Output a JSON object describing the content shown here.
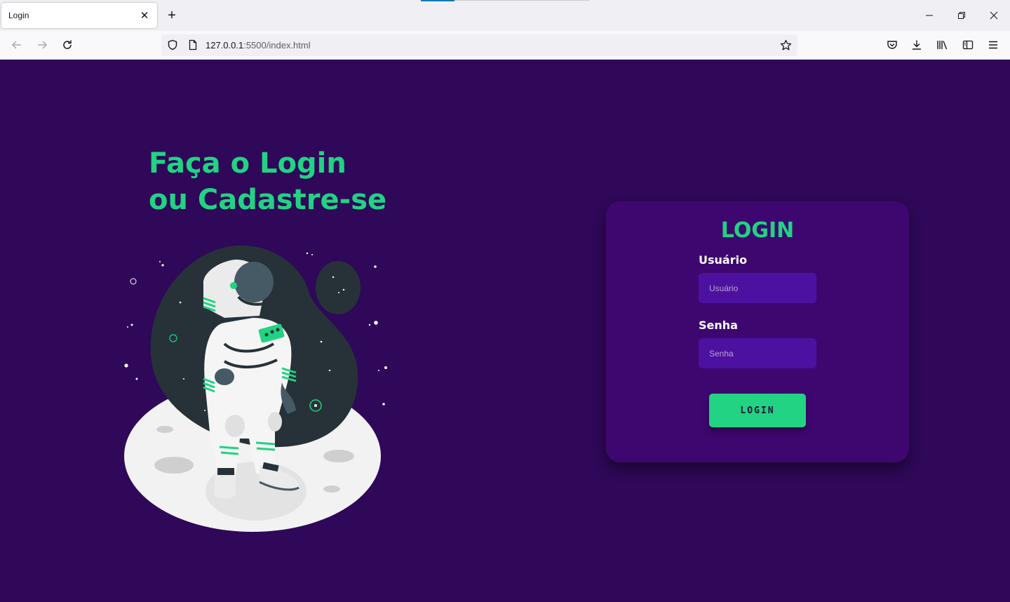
{
  "browser": {
    "tab_title": "Login",
    "tab_close_glyph": "✕",
    "new_tab_glyph": "+",
    "url_host": "127.0.0.1",
    "url_rest": ":5500/index.html"
  },
  "page": {
    "headline_line1": "Faça o Login",
    "headline_line2": "ou Cadastre-se",
    "illustration_subject": "astronaut-on-moon"
  },
  "login_card": {
    "title": "LOGIN",
    "username_label": "Usuário",
    "username_placeholder": "Usuário",
    "username_value": "",
    "password_label": "Senha",
    "password_placeholder": "Senha",
    "password_value": "",
    "submit_label": "LOGIN"
  },
  "colors": {
    "background": "#2f0859",
    "card": "#3e0770",
    "accent": "#21d382",
    "input": "#4c11a0"
  },
  "icons": [
    "close-icon",
    "plus-icon",
    "minimize-icon",
    "restore-icon",
    "window-close-icon",
    "back-arrow-icon",
    "forward-arrow-icon",
    "reload-icon",
    "shield-icon",
    "page-icon",
    "bookmark-star-icon",
    "pocket-icon",
    "download-icon",
    "library-icon",
    "sidebar-icon",
    "menu-icon"
  ]
}
